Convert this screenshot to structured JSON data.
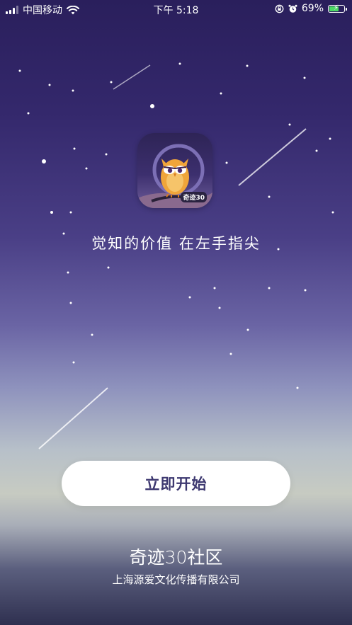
{
  "status_bar": {
    "carrier": "中国移动",
    "time": "下午 5:18",
    "battery_percent": "69%",
    "battery_level": 0.69,
    "icons": [
      "signal-icon",
      "wifi-icon",
      "orientation-lock-icon",
      "alarm-icon",
      "battery-icon"
    ]
  },
  "app": {
    "icon_name": "owl-app-icon",
    "icon_badge_text": "奇迹30",
    "slogan": "觉知的价值 在左手指尖"
  },
  "actions": {
    "start_label": "立即开始"
  },
  "footer": {
    "brand": "奇迹30社区",
    "company": "上海源爱文化传播有限公司"
  },
  "colors": {
    "button_text": "#3d3870",
    "button_bg": "#ffffff",
    "battery_fill": "#4cd964"
  }
}
